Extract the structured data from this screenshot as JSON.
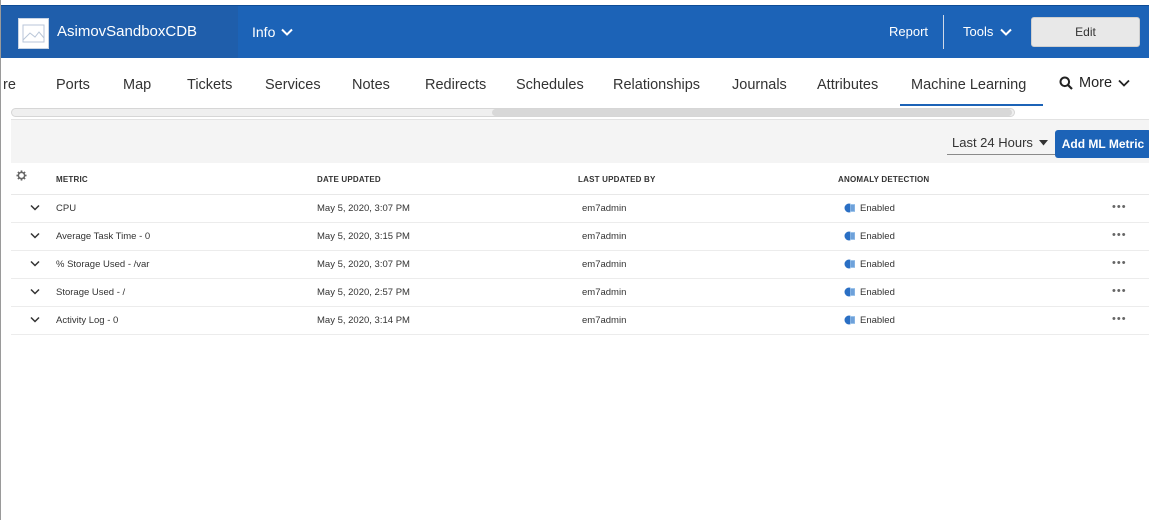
{
  "header": {
    "device_name": "AsimovSandboxCDB",
    "info_label": "Info",
    "report_label": "Report",
    "tools_label": "Tools",
    "edit_label": "Edit"
  },
  "tabs": {
    "partial_label": "re",
    "items": [
      "Ports",
      "Map",
      "Tickets",
      "Services",
      "Notes",
      "Redirects",
      "Schedules",
      "Relationships",
      "Journals",
      "Attributes",
      "Machine Learning"
    ],
    "active": "Machine Learning",
    "more_label": "More"
  },
  "toolbar": {
    "time_range": "Last 24 Hours",
    "add_button": "Add ML Metric"
  },
  "table": {
    "columns": [
      "Metric",
      "Date Updated",
      "Last Updated By",
      "Anomaly Detection"
    ],
    "rows": [
      {
        "metric": "CPU",
        "date": "May 5, 2020, 3:07 PM",
        "user": "em7admin",
        "status": "Enabled"
      },
      {
        "metric": "Average Task Time - 0",
        "date": "May 5, 2020, 3:15 PM",
        "user": "em7admin",
        "status": "Enabled"
      },
      {
        "metric": "% Storage Used - /var",
        "date": "May 5, 2020, 3:07 PM",
        "user": "em7admin",
        "status": "Enabled"
      },
      {
        "metric": "Storage Used - /",
        "date": "May 5, 2020, 2:57 PM",
        "user": "em7admin",
        "status": "Enabled"
      },
      {
        "metric": "Activity Log - 0",
        "date": "May 5, 2020, 3:14 PM",
        "user": "em7admin",
        "status": "Enabled"
      }
    ]
  },
  "colors": {
    "header_blue": "#1c63b7",
    "accent": "#1c63b7"
  },
  "icons": {
    "row_expand": "chevron-down-icon",
    "anomaly": "anomaly-detection-icon",
    "row_actions": "more-actions-icon",
    "settings": "gear-icon"
  }
}
